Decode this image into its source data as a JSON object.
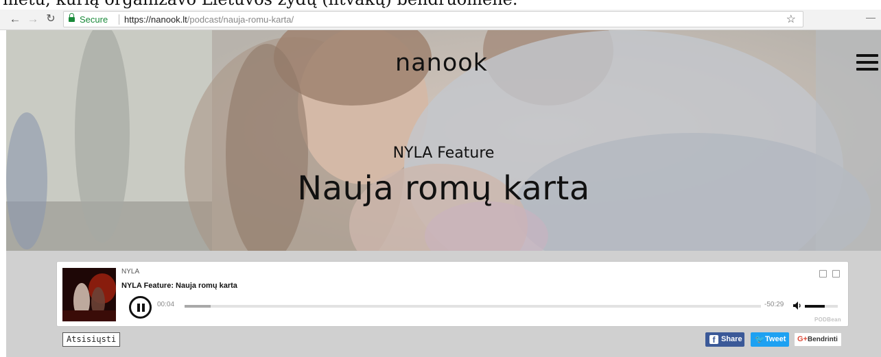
{
  "caption": {
    "text": "metu, kurią organizavo Lietuvos žydų (litvakų) bendruomenė."
  },
  "browser": {
    "secure_label": "Secure",
    "url_host": "https://nanook.lt",
    "url_path": "/podcast/nauja-romu-karta/",
    "back_icon": "arrow-left-icon",
    "forward_icon": "arrow-right-icon",
    "reload_icon": "reload-icon",
    "bookmark_icon": "star-icon"
  },
  "hero": {
    "logo": "nanook",
    "kicker": "NYLA Feature",
    "title": "Nauja romų karta",
    "menu_icon": "hamburger-icon"
  },
  "player": {
    "author": "NYLA",
    "episode_title": "NYLA Feature: Nauja romų karta",
    "elapsed": "00:04",
    "remaining": "-50:29",
    "progress": 0.045,
    "volume": 0.6,
    "brand": "PODBean",
    "play_state": "playing",
    "pause_icon": "pause-icon",
    "volume_icon": "speaker-icon",
    "download_icon": "download-icon",
    "share_icon": "share-icon"
  },
  "actions": {
    "download_label": "Atsisiųsti",
    "facebook_label": "Share",
    "twitter_label": "Tweet",
    "google_label": "Bendrinti"
  },
  "colors": {
    "secure_green": "#1a8a3a",
    "facebook": "#3b5998",
    "twitter": "#1da1f2",
    "google": "#dd4b39"
  }
}
